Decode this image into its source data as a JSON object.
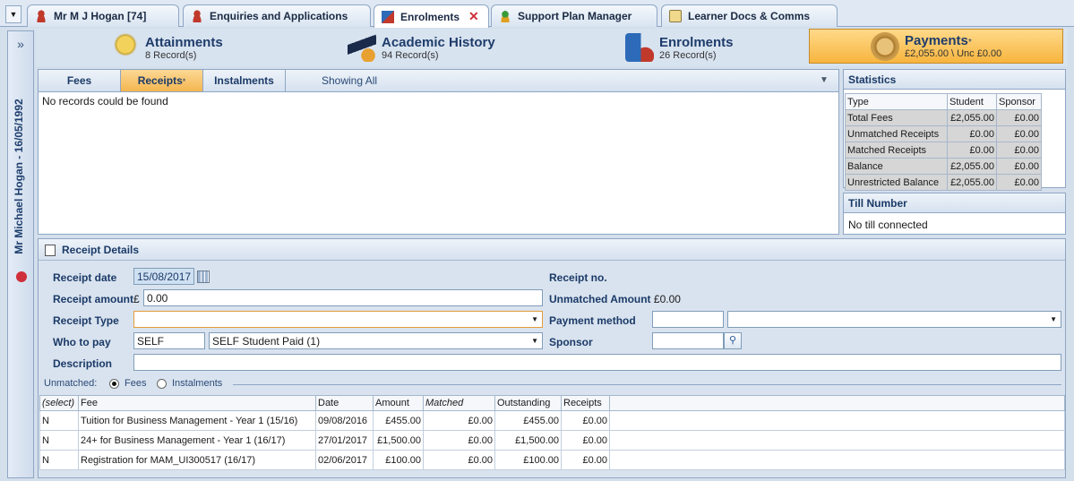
{
  "tabs": [
    {
      "label": "Mr M J Hogan [74]"
    },
    {
      "label": "Enquiries and Applications"
    },
    {
      "label": "Enrolments",
      "close": "✕"
    },
    {
      "label": "Support Plan Manager"
    },
    {
      "label": "Learner Docs & Comms"
    }
  ],
  "rail": {
    "expand": "»",
    "learner": "Mr Michael Hogan - 16/05/1992"
  },
  "summary": {
    "attainments": {
      "title": "Attainments",
      "sub": "8 Record(s)"
    },
    "history": {
      "title": "Academic History",
      "sub": "94 Record(s)"
    },
    "enrolments": {
      "title": "Enrolments",
      "sub": "26 Record(s)"
    },
    "payments": {
      "title": "Payments",
      "mark": "*",
      "sub": "£2,055.00 \\ Unc £0.00"
    }
  },
  "subtabs": {
    "fees": "Fees",
    "receipts": "Receipts",
    "receipts_mark": "*",
    "instalments": "Instalments",
    "showing": "Showing All"
  },
  "fee_list": {
    "empty": "No records could be found"
  },
  "statistics": {
    "title": "Statistics",
    "headers": [
      "Type",
      "Student",
      "Sponsor"
    ],
    "rows": [
      [
        "Total Fees",
        "£2,055.00",
        "£0.00"
      ],
      [
        "Unmatched Receipts",
        "£0.00",
        "£0.00"
      ],
      [
        "Matched Receipts",
        "£0.00",
        "£0.00"
      ],
      [
        "Balance",
        "£2,055.00",
        "£0.00"
      ],
      [
        "Unrestricted Balance",
        "£2,055.00",
        "£0.00"
      ]
    ]
  },
  "till": {
    "title": "Till Number",
    "value": "No till connected"
  },
  "receipt": {
    "title": "Receipt Details",
    "date_label": "Receipt date",
    "date_value": "15/08/2017",
    "amount_label": "Receipt amount",
    "currency": "£",
    "amount_value": "0.00",
    "type_label": "Receipt Type",
    "type_value": "",
    "who_label": "Who to pay",
    "who_code": "SELF",
    "who_value": "SELF Student Paid (1)",
    "desc_label": "Description",
    "desc_value": "",
    "no_label": "Receipt no.",
    "unmatched_label": "Unmatched Amount",
    "unmatched_value": "£0.00",
    "method_label": "Payment method",
    "method_code": "",
    "method_value": "",
    "sponsor_label": "Sponsor",
    "sponsor_value": "",
    "unmatched_by": "Unmatched:",
    "opt_fees": "Fees",
    "opt_instalments": "Instalments"
  },
  "grid": {
    "headers": [
      "(select)",
      "Fee",
      "Date",
      "Amount",
      "Matched",
      "Outstanding",
      "Receipts"
    ],
    "rows": [
      [
        "N",
        "Tuition for Business Management - Year 1 (15/16)",
        "09/08/2016",
        "£455.00",
        "£0.00",
        "£455.00",
        "£0.00"
      ],
      [
        "N",
        "24+ for Business Management - Year 1 (16/17)",
        "27/01/2017",
        "£1,500.00",
        "£0.00",
        "£1,500.00",
        "£0.00"
      ],
      [
        "N",
        "Registration for MAM_UI300517 (16/17)",
        "02/06/2017",
        "£100.00",
        "£0.00",
        "£100.00",
        "£0.00"
      ]
    ]
  },
  "colors": {
    "accent": "#f7b53e",
    "header": "#1b3a67",
    "close": "#d0303a"
  }
}
